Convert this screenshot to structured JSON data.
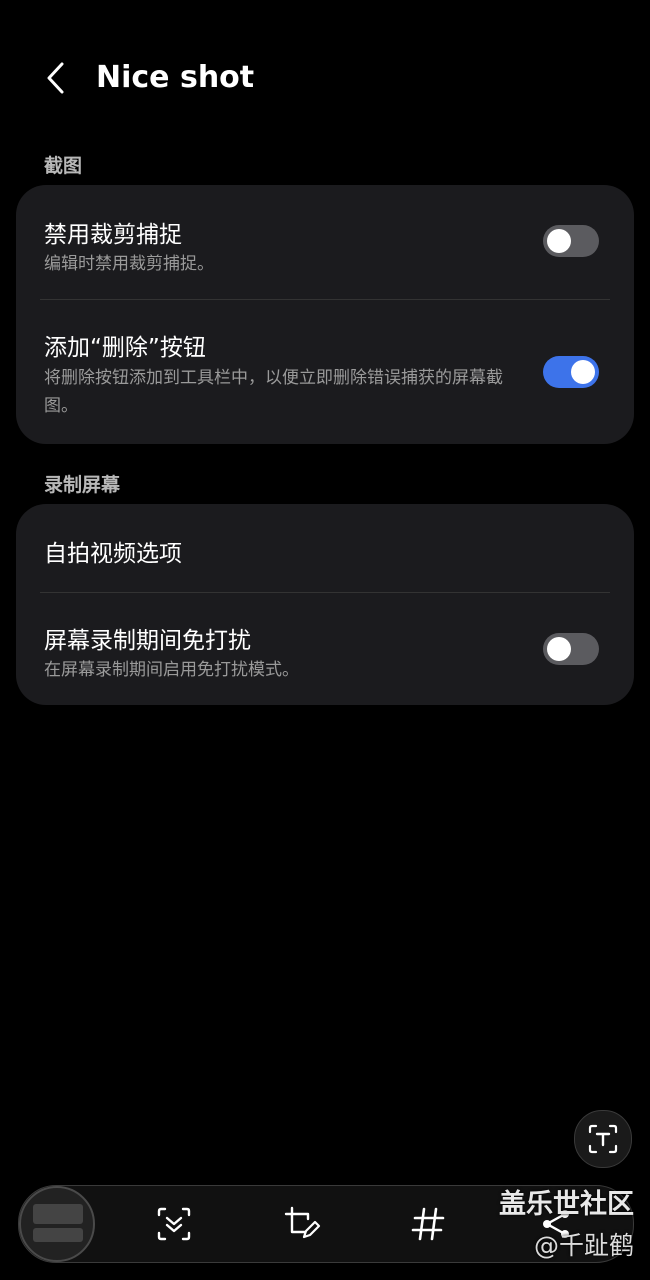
{
  "header": {
    "title": "Nice shot"
  },
  "sections": [
    {
      "label": "截图",
      "rows": [
        {
          "title": "禁用裁剪捕捉",
          "subtitle": "编辑时禁用裁剪捕捉。",
          "toggle": false
        },
        {
          "title": "添加“删除”按钮",
          "subtitle": "将删除按钮添加到工具栏中，以便立即删除错误捕获的屏幕截图。",
          "toggle": true
        }
      ]
    },
    {
      "label": "录制屏幕",
      "rows": [
        {
          "title": "自拍视频选项"
        },
        {
          "title": "屏幕录制期间免打扰",
          "subtitle": "在屏幕录制期间启用免打扰模式。",
          "toggle": false
        }
      ]
    }
  ],
  "toolbar": {
    "icons": [
      "scroll-capture-icon",
      "crop-edit-icon",
      "hashtag-icon",
      "share-icon"
    ]
  },
  "watermark": {
    "line1": "盖乐世社区",
    "line2": "@千趾鹤"
  },
  "colors": {
    "toggle_on": "#3d73ea",
    "toggle_off": "#5b5b5f",
    "card": "#1b1b1e"
  }
}
